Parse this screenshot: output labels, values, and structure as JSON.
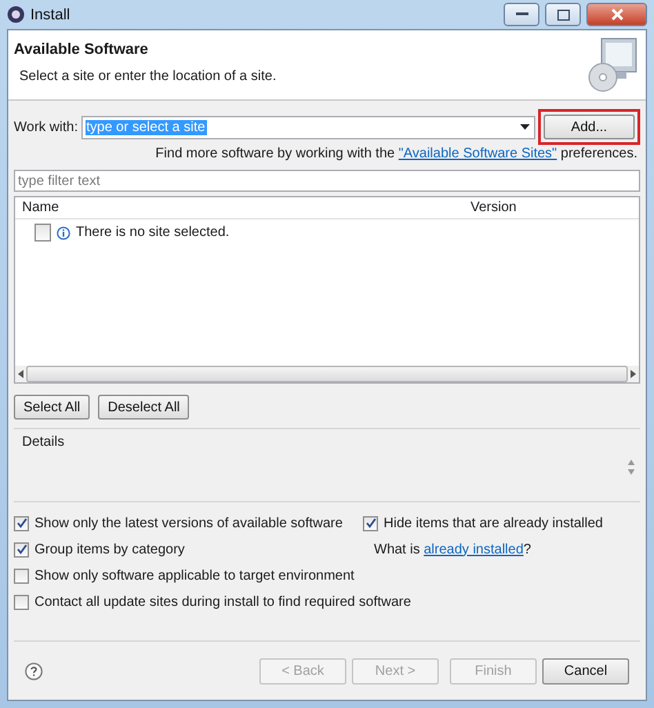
{
  "window": {
    "title": "Install"
  },
  "header": {
    "title": "Available Software",
    "subtitle": "Select a site or enter the location of a site."
  },
  "work_with": {
    "label": "Work with:",
    "value": "type or select a site",
    "selected": true,
    "add_button": "Add...",
    "highlighted": true
  },
  "more_software": {
    "text": "Find more software by working with the",
    "link": "\"Available Software Sites\"",
    "suffix": "preferences."
  },
  "filter": {
    "placeholder": "type filter text"
  },
  "table": {
    "columns": [
      "Name",
      "Version"
    ],
    "rows": [
      {
        "text": "There is no site selected.",
        "checked": false
      }
    ]
  },
  "selection_buttons": [
    {
      "label": "Select All"
    },
    {
      "label": "Deselect All"
    }
  ],
  "details": {
    "title": "Details"
  },
  "options_left": [
    {
      "label": "Show only the latest versions of available software",
      "checked": true
    },
    {
      "label": "Group items by category",
      "checked": true
    },
    {
      "label": "Show only software applicable to target environment",
      "checked": false
    },
    {
      "label": "Contact all update sites during install to find required software",
      "checked": false
    }
  ],
  "options_right": {
    "hide_installed": {
      "label": "Hide items that are already installed",
      "checked": true
    },
    "what_is": "What is",
    "link": "already installed",
    "suffix": "?"
  },
  "footer_buttons": [
    {
      "label": "< Back",
      "disabled": true
    },
    {
      "label": "Next >",
      "disabled": true
    },
    {
      "label": "Finish",
      "disabled": true
    },
    {
      "label": "Cancel",
      "disabled": false
    }
  ]
}
